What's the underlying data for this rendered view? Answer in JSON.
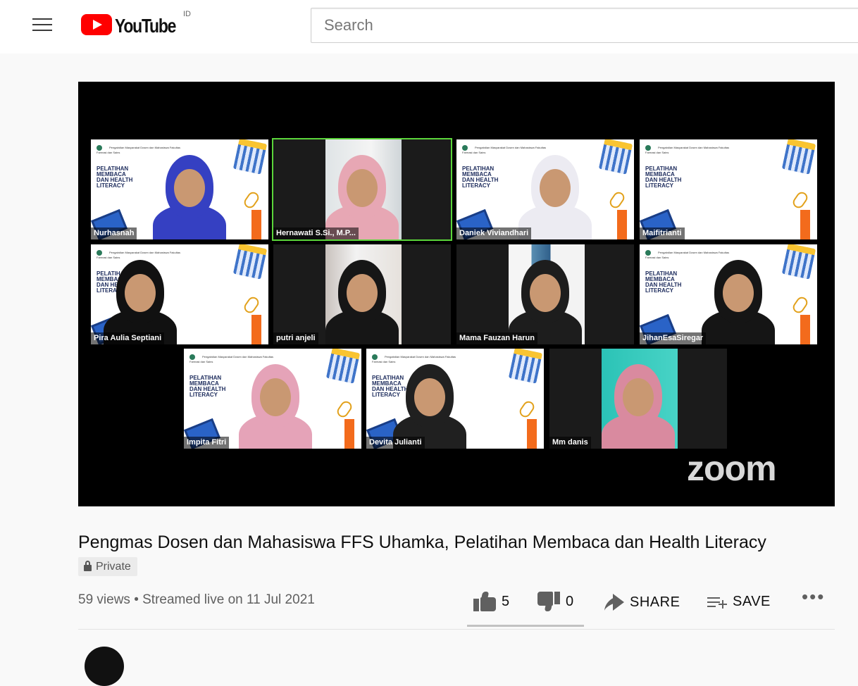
{
  "header": {
    "logo_text": "YouTube",
    "country_code": "ID",
    "search_placeholder": "Search"
  },
  "meeting": {
    "participants": [
      {
        "name": "Nurhasnah",
        "background": "slide",
        "hijab_color": "#3540c2"
      },
      {
        "name": "Hernawati S.Si., M.P...",
        "background": "room",
        "active": true,
        "hijab_color": "#e7a7b4"
      },
      {
        "name": "Daniek Viviandhari",
        "background": "slide",
        "hijab_color": "#ecebf2"
      },
      {
        "name": "Maifitrianti",
        "background": "slide",
        "hijab_color": ""
      },
      {
        "name": "Pira Aulia Septiani",
        "background": "slide",
        "hijab_color": "#111111"
      },
      {
        "name": "putri anjeli",
        "background": "room",
        "hijab_color": "#161616"
      },
      {
        "name": "Mama Fauzan Harun",
        "background": "room",
        "hijab_color": "#1d1d1d"
      },
      {
        "name": "JihanEsaSiregar",
        "background": "slide",
        "hijab_color": "#151515"
      },
      {
        "name": "Impita Fitri",
        "background": "slide",
        "hijab_color": "#e5a3b8"
      },
      {
        "name": "Devita Julianti",
        "background": "slide",
        "hijab_color": "#202020"
      },
      {
        "name": "Mm danis",
        "background": "room",
        "hijab_color": "#d98a9f"
      }
    ],
    "slide_title": "PELATIHAN\nMEMBACA\nDAN HEALTH\nLITERACY",
    "slide_header": "Pengabdian Masyarakat Dosen dan Mahasiswa Fakultas Farmasi dan Sains",
    "watermark": "zoom"
  },
  "video": {
    "title": "Pengmas Dosen dan Mahasiswa FFS Uhamka, Pelatihan Membaca dan Health Literacy",
    "privacy": "Private",
    "views_and_date": "59 views • Streamed live on 11 Jul 2021"
  },
  "actions": {
    "likes": "5",
    "dislikes": "0",
    "share_label": "SHARE",
    "save_label": "SAVE",
    "more_label": "•••"
  }
}
